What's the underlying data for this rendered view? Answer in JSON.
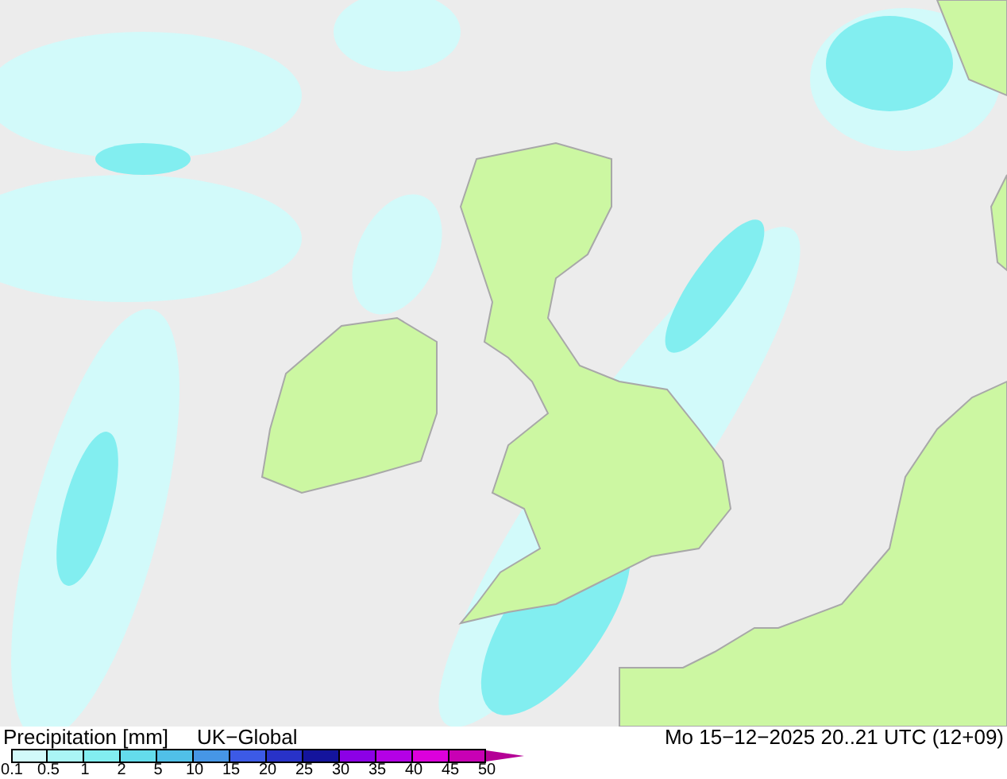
{
  "legend": {
    "title": "Precipitation [mm]",
    "model": "UK−Global",
    "valid_time": "Mo 15−12−2025 20..21 UTC (12+09)",
    "segments": [
      {
        "color": "#d2fafa"
      },
      {
        "color": "#aaf5f5"
      },
      {
        "color": "#82eef0"
      },
      {
        "color": "#64dcec"
      },
      {
        "color": "#50c0e8"
      },
      {
        "color": "#4696e6"
      },
      {
        "color": "#3c5ae6"
      },
      {
        "color": "#2832c8"
      },
      {
        "color": "#14149c"
      },
      {
        "color": "#8c00e6"
      },
      {
        "color": "#b400e6"
      },
      {
        "color": "#dc00dc"
      },
      {
        "color": "#c800b4"
      }
    ],
    "overflow_arrow": {
      "color": "#b40096"
    },
    "ticks": [
      "0.1",
      "0.5",
      "1",
      "2",
      "5",
      "10",
      "15",
      "20",
      "25",
      "30",
      "35",
      "40",
      "45",
      "50"
    ]
  }
}
